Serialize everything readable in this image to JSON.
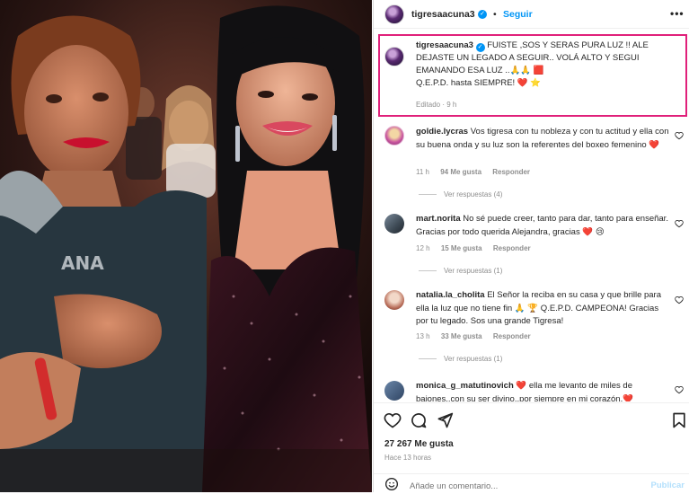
{
  "post": {
    "username": "tigresaacuna3",
    "follow_label": "Seguir",
    "more_label": "•••",
    "verified_mark": "✓"
  },
  "caption": {
    "username": "tigresaacuna3",
    "text": "FUISTE ,SOS Y SERAS PURA LUZ !! ALE DEJASTE UN LEGADO A SEGUIR.. VOLÁ ALTO Y SEGUI EMANANDO ESA LUZ ..🙏🙏 🟥",
    "text2": "Q.E.P.D. hasta SIEMPRE! ❤️ ⭐",
    "meta": "Editado · 9 h"
  },
  "comments": [
    {
      "username": "goldie.lycras",
      "text": "Vos tigresa con tu nobleza y con tu actitud y ella con su buena onda y su luz son la referentes del boxeo femenino ❤️",
      "time": "11 h",
      "likes": "94 Me gusta",
      "reply": "Responder",
      "replies": "Ver respuestas (4)"
    },
    {
      "username": "mart.norita",
      "text": "No sé puede creer, tanto para dar, tanto para enseñar. Gracias por todo querida Alejandra, gracias ❤️ 😢",
      "time": "12 h",
      "likes": "15 Me gusta",
      "reply": "Responder",
      "replies": "Ver respuestas (1)"
    },
    {
      "username": "natalia.la_cholita",
      "text": "El Señor la reciba en su casa y que brille para ella la luz que no tiene fin 🙏 🏆 Q.E.P.D. CAMPEONA! Gracias por tu legado. Sos una grande Tigresa!",
      "time": "13 h",
      "likes": "33 Me gusta",
      "reply": "Responder",
      "replies": "Ver respuestas (1)"
    },
    {
      "username": "monica_g_matutinovich",
      "text": "❤️ ella me levanto de miles de bajones..con su ser divino..por siempre en mi corazón.❤️"
    }
  ],
  "footer": {
    "likes": "27 267 Me gusta",
    "ago": "Hace 13 horas",
    "comment_placeholder": "Añade un comentario...",
    "publish_label": "Publicar"
  },
  "colors": {
    "accent": "#0095f6",
    "highlight": "#e0207a",
    "heart": "#ed4956"
  }
}
